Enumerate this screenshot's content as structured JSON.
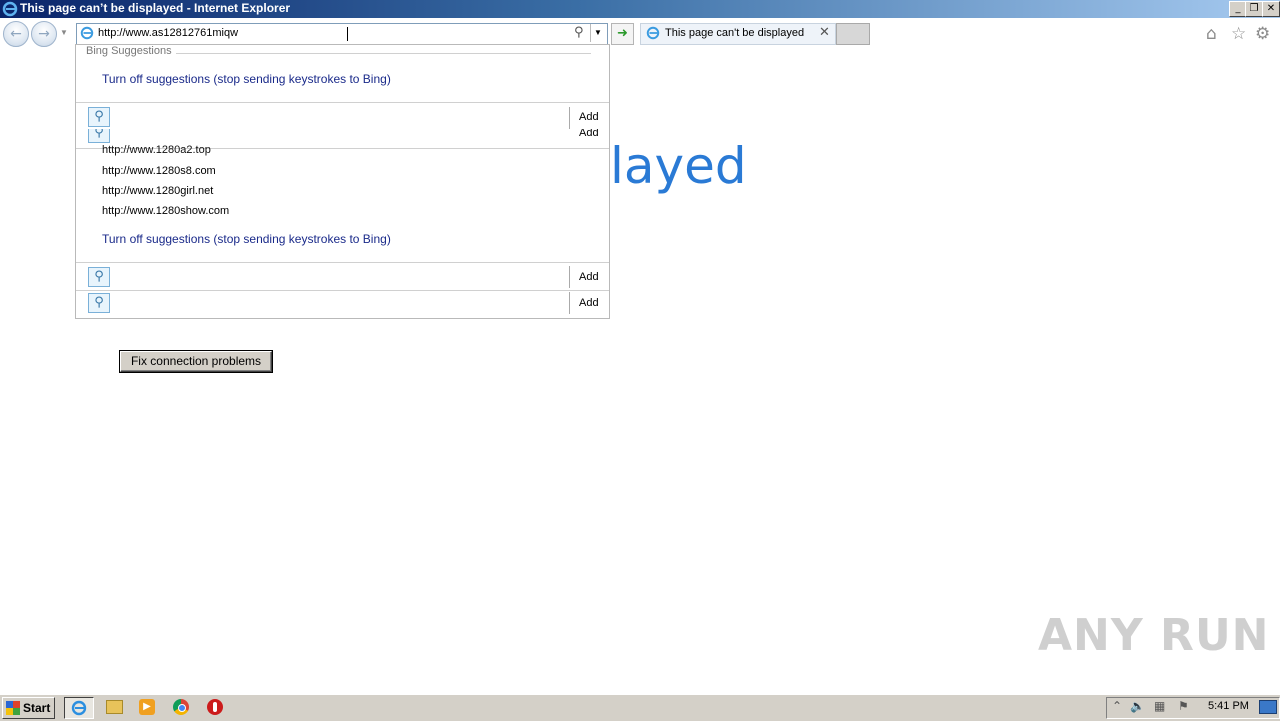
{
  "window": {
    "title": "This page can’t be displayed - Internet Explorer",
    "minimize_icon": "minimize-icon",
    "restore_icon": "restore-icon",
    "close_icon": "close-icon"
  },
  "navbar": {
    "back_icon": "back-arrow-icon",
    "forward_icon": "forward-arrow-icon",
    "address_value": "http://www.as12812761miqw",
    "go_icon": "go-arrow-icon",
    "home_icon": "home-icon",
    "favorites_icon": "star-icon",
    "tools_icon": "gear-icon"
  },
  "tab": {
    "title": "This page can't be displayed"
  },
  "page": {
    "heading_partial": "layed",
    "fix_button": "Fix connection problems"
  },
  "dropdown": {
    "section_label": "Bing Suggestions",
    "turn_off_1": "Turn off suggestions (stop sending keystrokes to Bing)",
    "add_label": "Add",
    "partial_url": "http://www.1280a2.top",
    "urls": [
      "http://www.1280s8.com",
      "http://www.1280girl.net",
      "http://www.1280show.com"
    ],
    "turn_off_2": "Turn off suggestions (stop sending keystrokes to Bing)"
  },
  "taskbar": {
    "start_label": "Start",
    "clock": "5:41 PM"
  },
  "watermark": "ANY RUN",
  "colors": {
    "title_bar": "#0a246a",
    "link_blue": "#2a7ad5",
    "suggestion_text": "#1a2a8a"
  }
}
